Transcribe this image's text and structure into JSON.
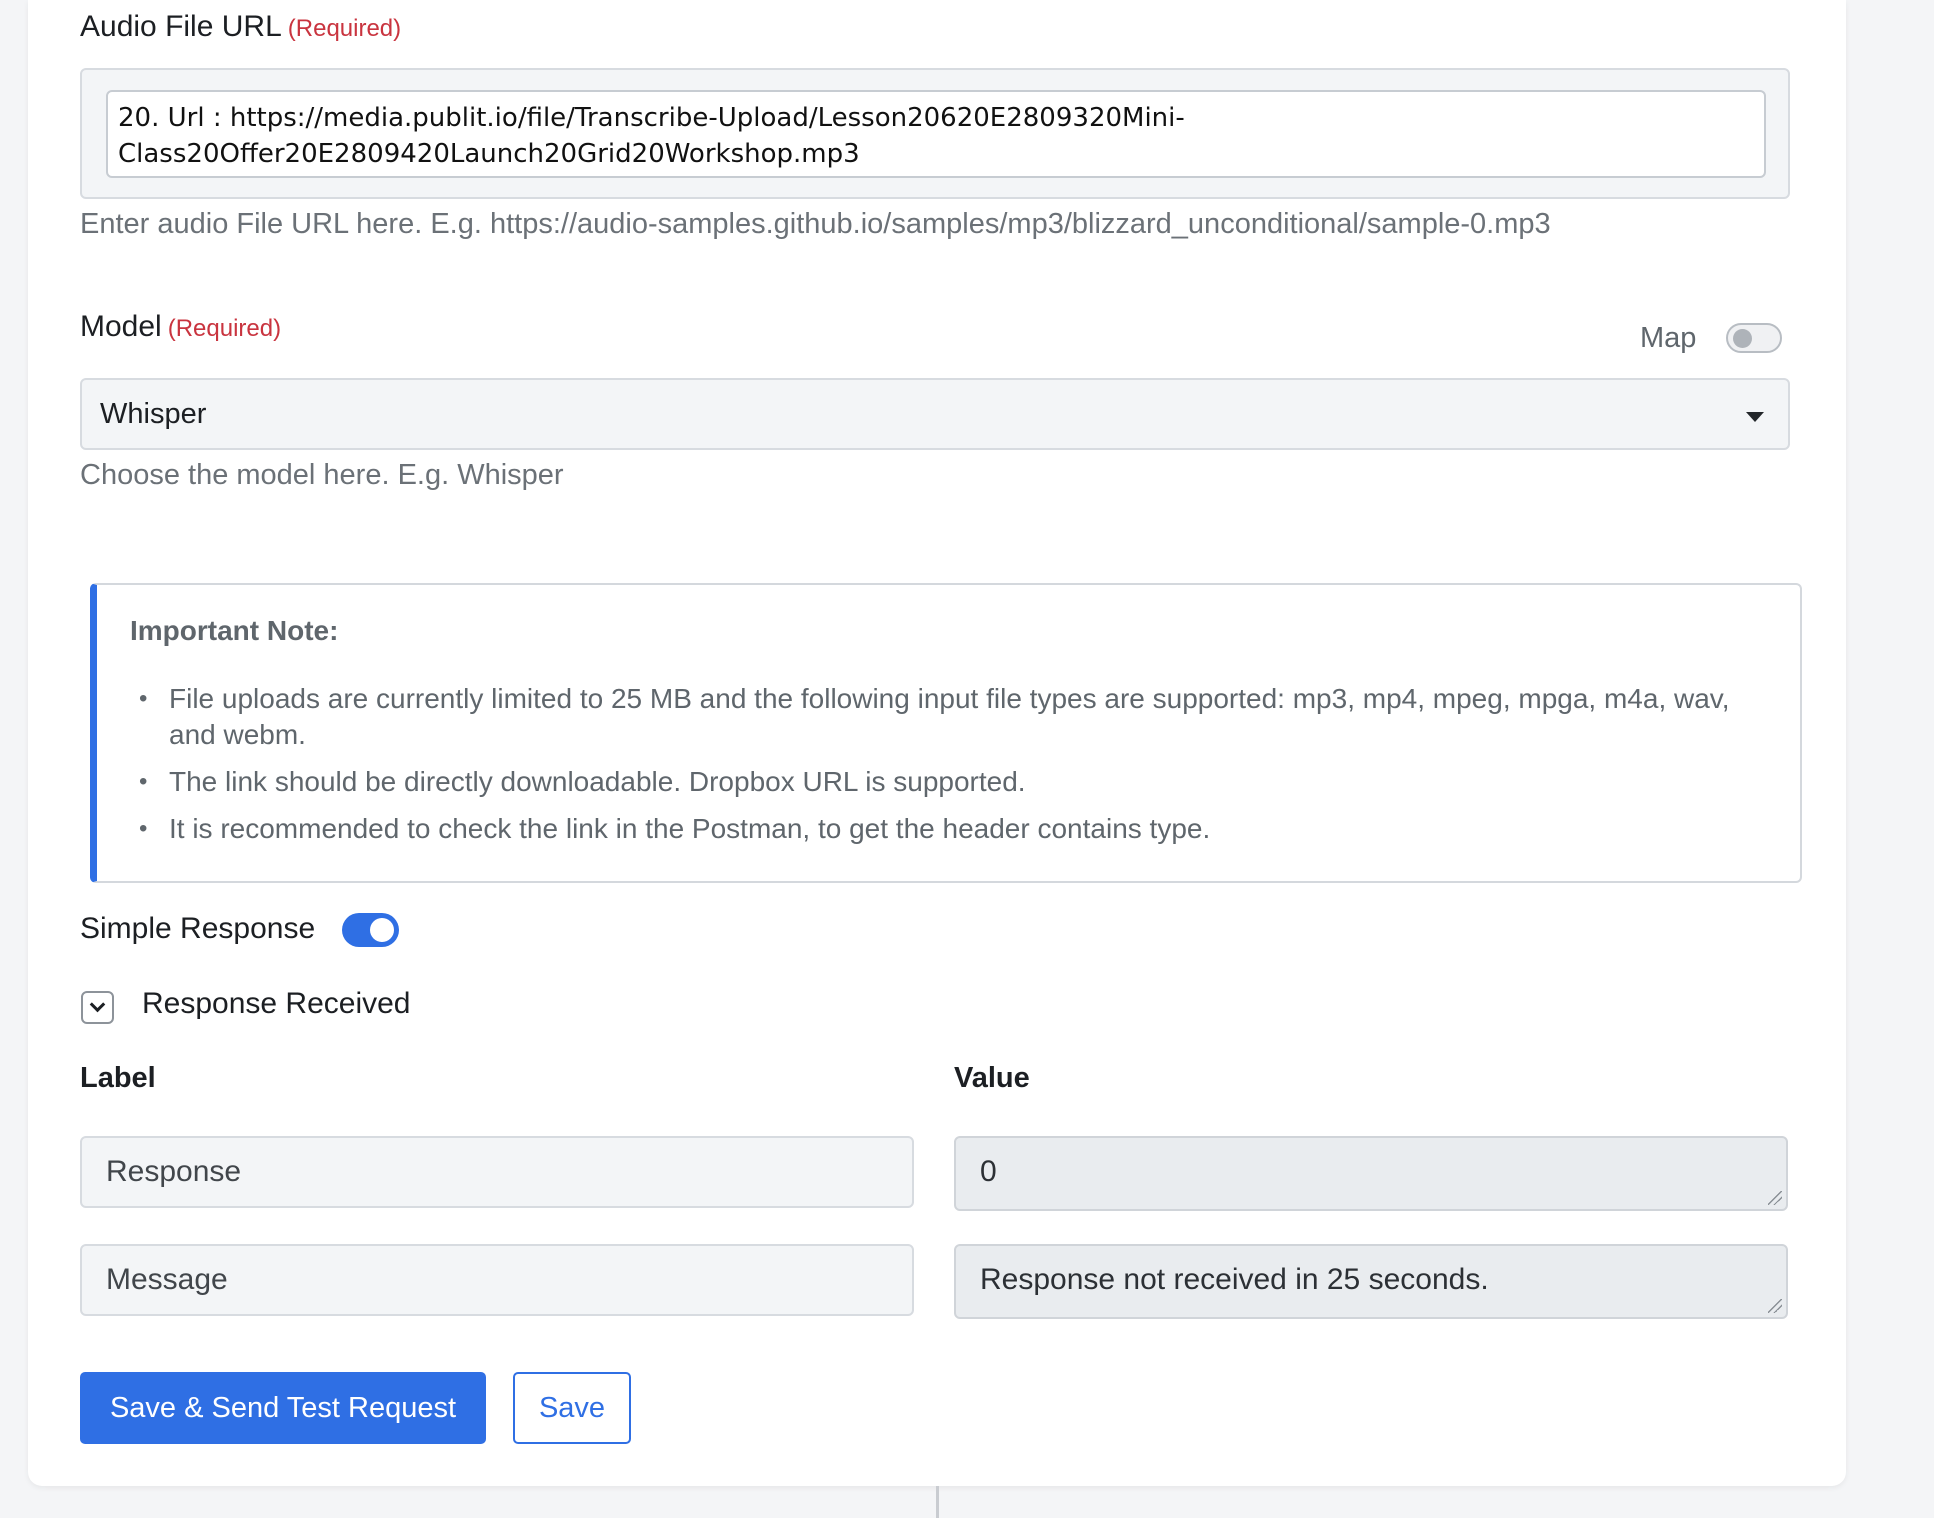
{
  "audio_url": {
    "label": "Audio File URL",
    "required": "(Required)",
    "value_line1": "20. Url : https://media.publit.io/file/Transcribe-Upload/Lesson20620E2809320Mini-",
    "value_line2": "Class20Offer20E2809420Launch20Grid20Workshop.mp3",
    "help": "Enter audio File URL here. E.g. https://audio-samples.github.io/samples/mp3/blizzard_unconditional/sample-0.mp3"
  },
  "model": {
    "label": "Model",
    "required": "(Required)",
    "map_label": "Map",
    "map_enabled": false,
    "selected": "Whisper",
    "help": "Choose the model here. E.g. Whisper"
  },
  "note": {
    "title": "Important Note:",
    "items": [
      "File uploads are currently limited to 25 MB and the following input file types are supported: mp3, mp4, mpeg, mpga, m4a, wav, and webm.",
      "The link should be directly downloadable. Dropbox URL is supported.",
      "It is recommended to check the link in the Postman, to get the header contains type."
    ],
    "accent_color": "#2f6fe4"
  },
  "simple_response": {
    "label": "Simple Response",
    "enabled": true
  },
  "response_received": {
    "label": "Response Received",
    "columns": {
      "label": "Label",
      "value": "Value"
    },
    "rows": [
      {
        "label": "Response",
        "value": "0"
      },
      {
        "label": "Message",
        "value": "Response not received in 25 seconds."
      }
    ]
  },
  "buttons": {
    "primary": "Save & Send Test Request",
    "secondary": "Save"
  },
  "colors": {
    "primary": "#2f6fe4",
    "required": "#c9343f"
  }
}
